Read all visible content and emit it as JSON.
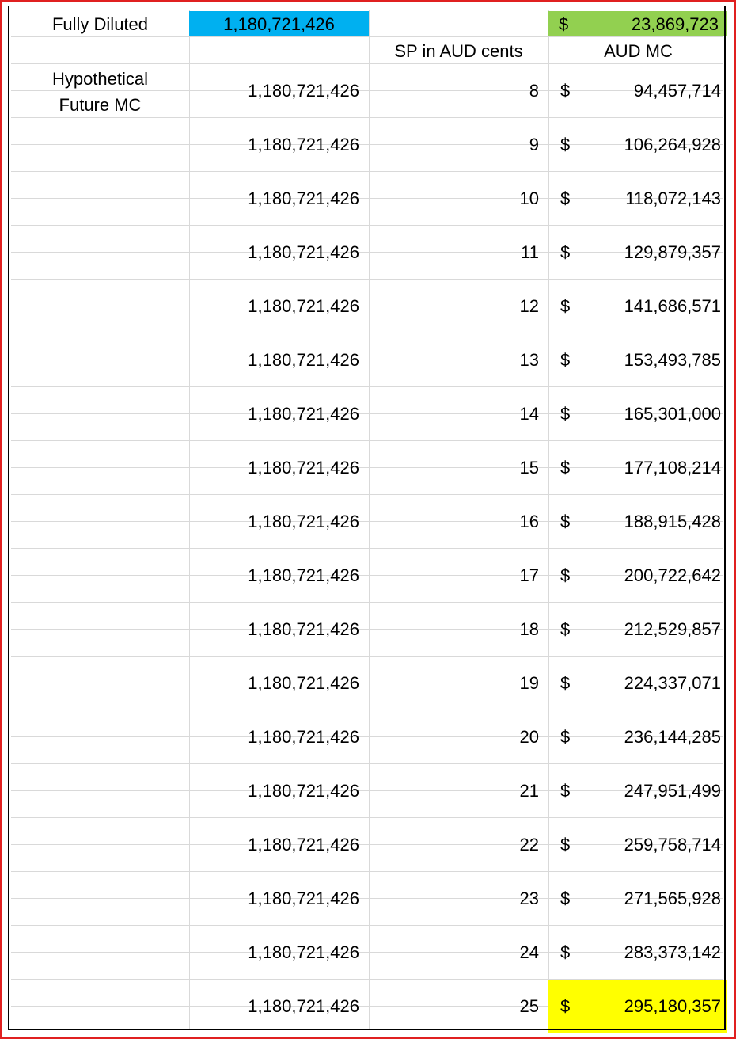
{
  "header": {
    "label": "Fully Diluted",
    "shares": "1,180,721,426",
    "currency": "$",
    "market_cap": "23,869,723"
  },
  "columns": {
    "sp_header": "SP in AUD cents",
    "mc_header": "AUD MC"
  },
  "section_label": {
    "line1": "Hypothetical",
    "line2": "Future MC"
  },
  "highlight_color_shares": "#00b0f0",
  "highlight_color_current_mc": "#92d050",
  "highlight_color_top_mc": "#ffff00",
  "rows": [
    {
      "shares": "1,180,721,426",
      "sp": "8",
      "currency": "$",
      "mc": "94,457,714"
    },
    {
      "shares": "1,180,721,426",
      "sp": "9",
      "currency": "$",
      "mc": "106,264,928"
    },
    {
      "shares": "1,180,721,426",
      "sp": "10",
      "currency": "$",
      "mc": "118,072,143"
    },
    {
      "shares": "1,180,721,426",
      "sp": "11",
      "currency": "$",
      "mc": "129,879,357"
    },
    {
      "shares": "1,180,721,426",
      "sp": "12",
      "currency": "$",
      "mc": "141,686,571"
    },
    {
      "shares": "1,180,721,426",
      "sp": "13",
      "currency": "$",
      "mc": "153,493,785"
    },
    {
      "shares": "1,180,721,426",
      "sp": "14",
      "currency": "$",
      "mc": "165,301,000"
    },
    {
      "shares": "1,180,721,426",
      "sp": "15",
      "currency": "$",
      "mc": "177,108,214"
    },
    {
      "shares": "1,180,721,426",
      "sp": "16",
      "currency": "$",
      "mc": "188,915,428"
    },
    {
      "shares": "1,180,721,426",
      "sp": "17",
      "currency": "$",
      "mc": "200,722,642"
    },
    {
      "shares": "1,180,721,426",
      "sp": "18",
      "currency": "$",
      "mc": "212,529,857"
    },
    {
      "shares": "1,180,721,426",
      "sp": "19",
      "currency": "$",
      "mc": "224,337,071"
    },
    {
      "shares": "1,180,721,426",
      "sp": "20",
      "currency": "$",
      "mc": "236,144,285"
    },
    {
      "shares": "1,180,721,426",
      "sp": "21",
      "currency": "$",
      "mc": "247,951,499"
    },
    {
      "shares": "1,180,721,426",
      "sp": "22",
      "currency": "$",
      "mc": "259,758,714"
    },
    {
      "shares": "1,180,721,426",
      "sp": "23",
      "currency": "$",
      "mc": "271,565,928"
    },
    {
      "shares": "1,180,721,426",
      "sp": "24",
      "currency": "$",
      "mc": "283,373,142"
    },
    {
      "shares": "1,180,721,426",
      "sp": "25",
      "currency": "$",
      "mc": "295,180,357"
    }
  ]
}
